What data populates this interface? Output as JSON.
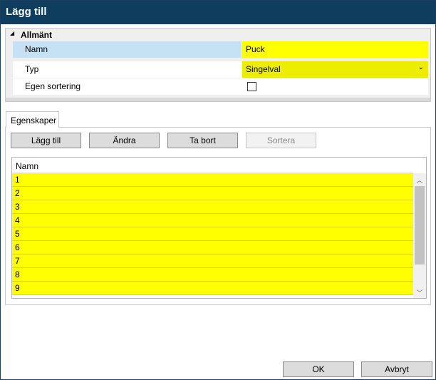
{
  "window": {
    "title": "Lägg till"
  },
  "propgrid": {
    "category": "Allmänt",
    "rows": [
      {
        "label": "Namn",
        "value": "Puck"
      },
      {
        "label": "Typ",
        "value": "Singelval"
      },
      {
        "label": "Egen sortering",
        "checked": false
      }
    ]
  },
  "tabs": [
    {
      "label": "Egenskaper"
    }
  ],
  "toolbar": {
    "add_label": "Lägg till",
    "edit_label": "Ändra",
    "remove_label": "Ta bort",
    "sort_label": "Sortera"
  },
  "list": {
    "header": "Namn",
    "items": [
      "1",
      "2",
      "3",
      "4",
      "5",
      "6",
      "7",
      "8",
      "9"
    ]
  },
  "footer": {
    "ok_label": "OK",
    "cancel_label": "Avbryt"
  },
  "colors": {
    "titlebar": "#0f3d5e",
    "highlight": "#ffff00",
    "selected_row": "#c5e1f4"
  }
}
